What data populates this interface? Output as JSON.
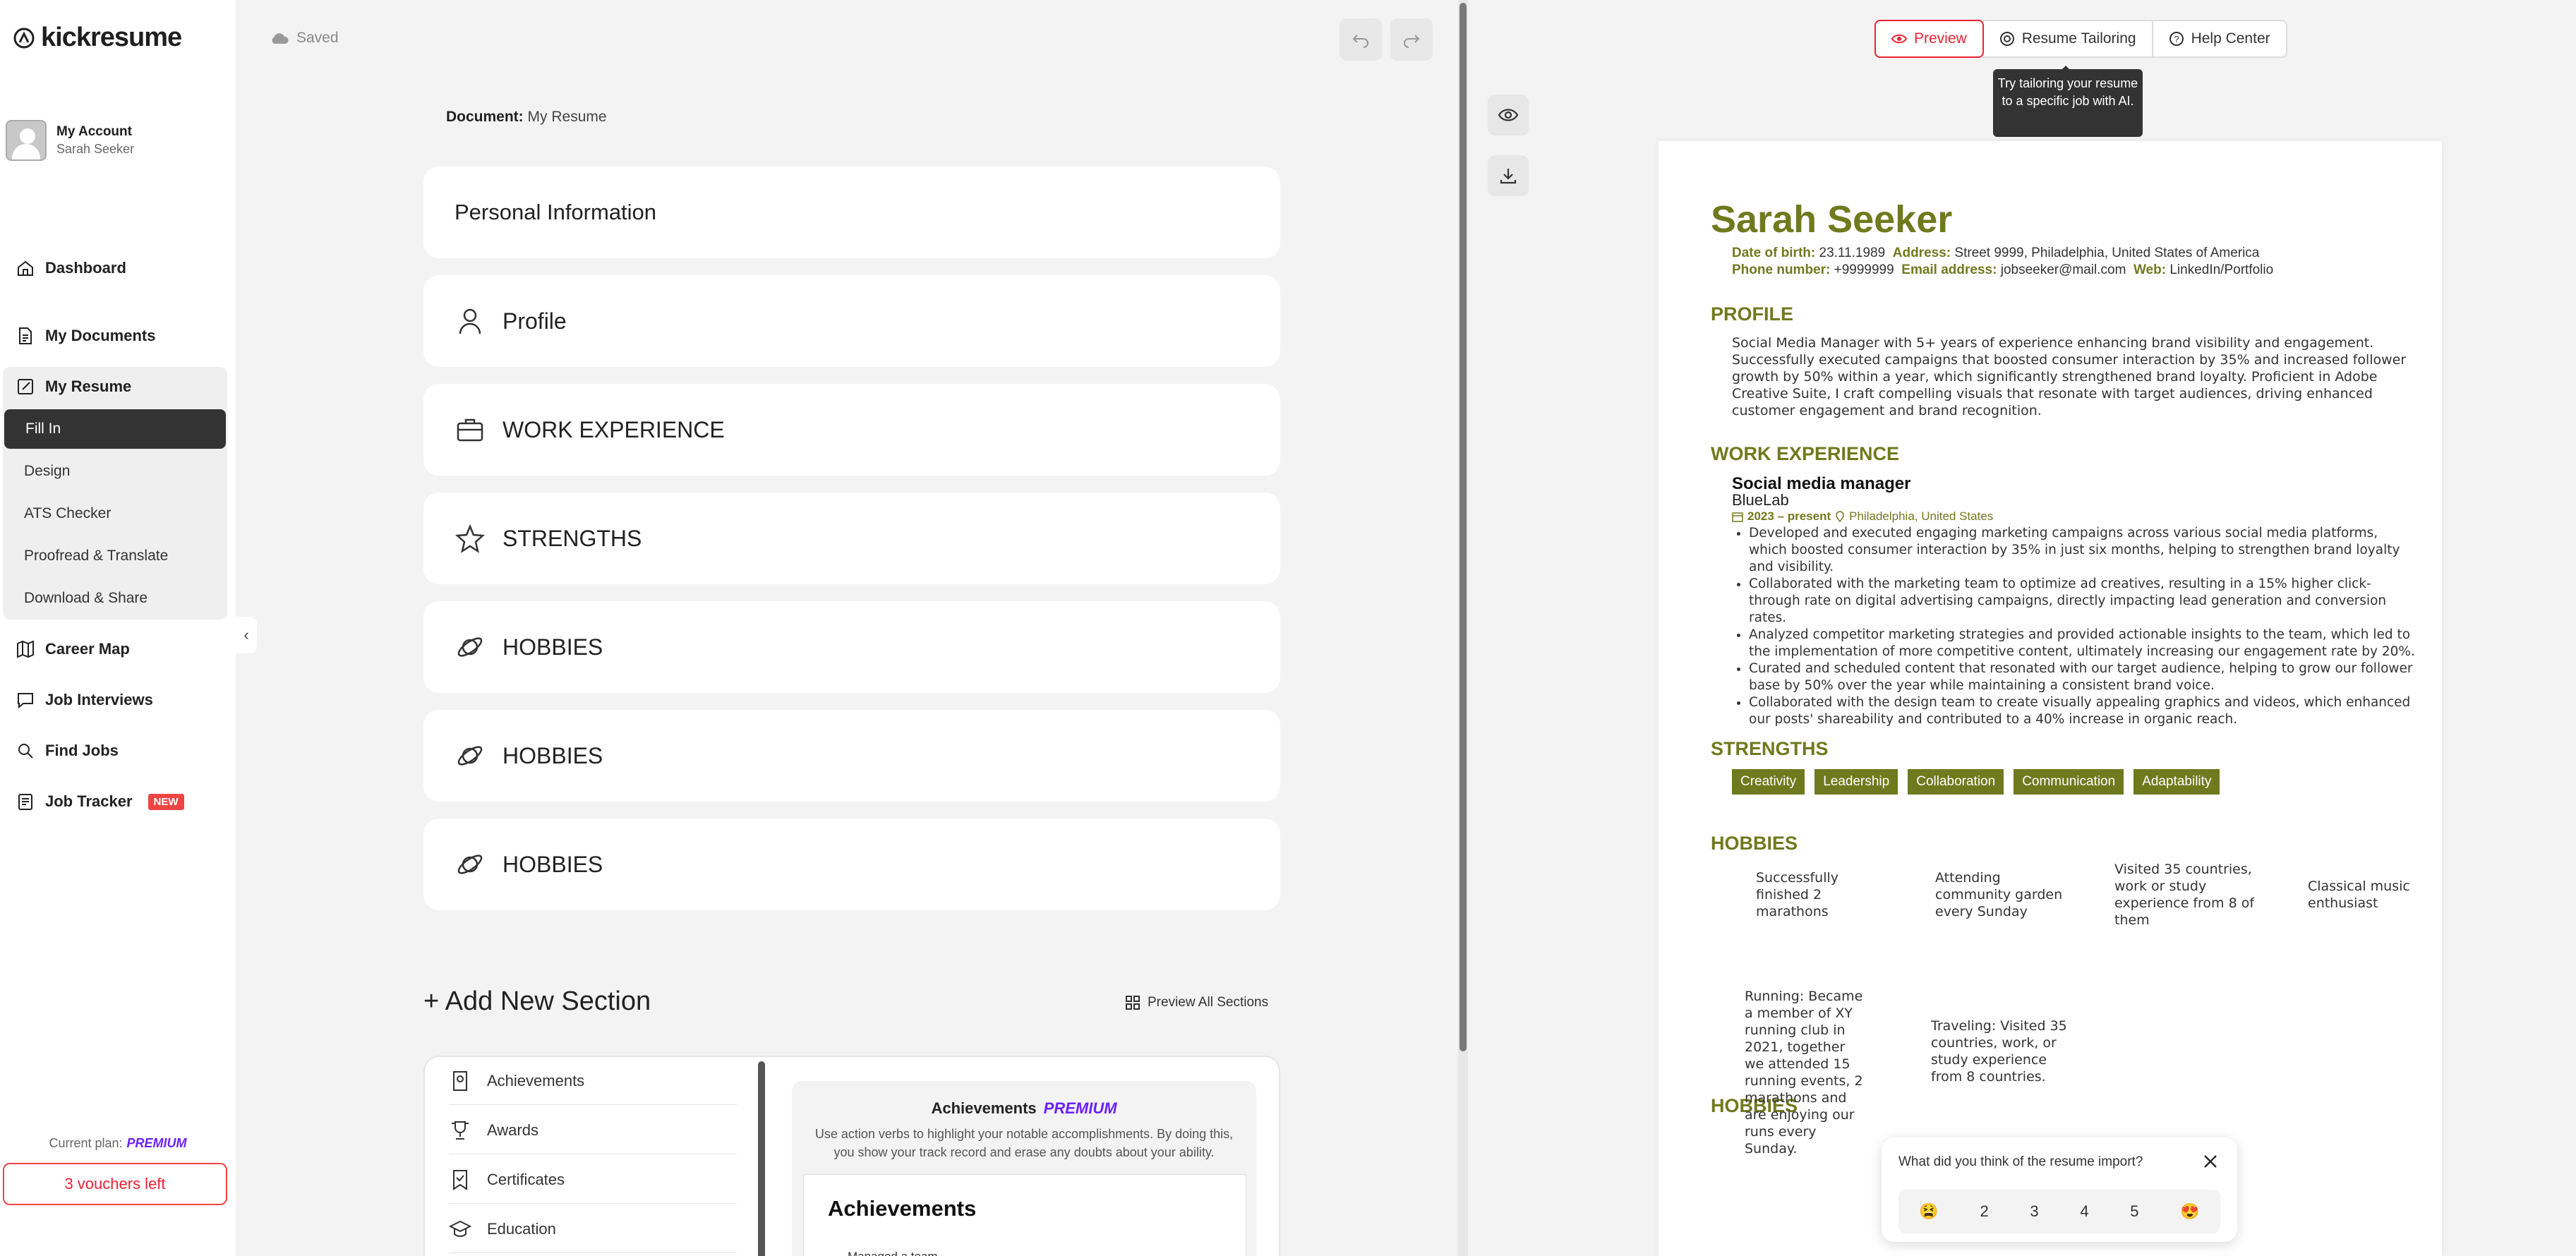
{
  "app": {
    "logo_text": "kickresume"
  },
  "account": {
    "label": "My Account",
    "user": "Sarah Seeker"
  },
  "nav": {
    "dashboard": "Dashboard",
    "my_documents": "My Documents",
    "my_resume": "My Resume",
    "sub": [
      "Fill In",
      "Design",
      "ATS Checker",
      "Proofread & Translate",
      "Download & Share"
    ],
    "career_map": "Career Map",
    "job_interviews": "Job Interviews",
    "find_jobs": "Find Jobs",
    "job_tracker": "Job Tracker",
    "new_badge": "NEW"
  },
  "plan": {
    "label": "Current plan:",
    "value": "PREMIUM",
    "vouchers": "3 vouchers left"
  },
  "editor": {
    "saved": "Saved",
    "doc_label": "Document:",
    "doc_name": "My Resume",
    "sections": [
      "Personal Information",
      "Profile",
      "WORK EXPERIENCE",
      "STRENGTHS",
      "HOBBIES",
      "HOBBIES",
      "HOBBIES"
    ],
    "add_section": "+ Add New Section",
    "preview_all": "Preview All Sections",
    "library": [
      "Achievements",
      "Awards",
      "Certificates",
      "Education"
    ],
    "lib_preview": {
      "title": "Achievements",
      "premium": "PREMIUM",
      "desc": "Use action verbs to highlight your notable accomplishments. By doing this, you show your track record and erase any doubts about your ability.",
      "card_title": "Achievements",
      "card_line": "Managed a team..."
    }
  },
  "preview": {
    "tabs": [
      "Preview",
      "Resume Tailoring",
      "Help Center"
    ],
    "tooltip": "Try tailoring your resume to a specific job with AI."
  },
  "resume": {
    "name": "Sarah Seeker",
    "dob_label": "Date of birth:",
    "dob": "23.11.1989",
    "address_label": "Address:",
    "address": "Street 9999, Philadelphia, United States of America",
    "phone_label": "Phone number:",
    "phone": "+9999999",
    "email_label": "Email address:",
    "email": "jobseeker@mail.com",
    "web_label": "Web:",
    "web": "LinkedIn/Portfolio",
    "profile_h": "PROFILE",
    "profile_text": "Social Media Manager with 5+ years of experience enhancing brand visibility and engagement. Successfully executed campaigns that boosted consumer interaction by 35% and increased follower growth by 50% within a year, which significantly strengthened brand loyalty. Proficient in Adobe Creative Suite, I craft compelling visuals that resonate with target audiences, driving enhanced customer engagement and brand recognition.",
    "work_h": "WORK EXPERIENCE",
    "job_title": "Social media manager",
    "company": "BlueLab",
    "job_dates": "2023 – present",
    "job_location": "Philadelphia, United States",
    "bullets": [
      "Developed and executed engaging marketing campaigns across various social media platforms, which boosted consumer interaction by 35% in just six months, helping to strengthen brand loyalty and visibility.",
      "Collaborated with the marketing team to optimize ad creatives, resulting in a 15% higher click-through rate on digital advertising campaigns, directly impacting lead generation and conversion rates.",
      "Analyzed competitor marketing strategies and provided actionable insights to the team, which led to the implementation of more competitive content, ultimately increasing our engagement rate by 20%.",
      "Curated and scheduled content that resonated with our target audience, helping to grow our follower base by 50% over the year while maintaining a consistent brand voice.",
      "Collaborated with the design team to create visually appealing graphics and videos, which enhanced our posts' shareability and contributed to a 40% increase in organic reach."
    ],
    "strengths_h": "STRENGTHS",
    "strengths": [
      "Creativity",
      "Leadership",
      "Collaboration",
      "Communication",
      "Adaptability"
    ],
    "hobbies_h1": "HOBBIES",
    "hobbies1": [
      "Successfully finished 2 marathons",
      "Attending community garden every Sunday",
      "Visited 35 countries, work or study experience from 8 of them",
      "Classical music enthusiast"
    ],
    "hobbies_h2": "HOBBIES",
    "hobbies2": [
      "Running: Became a member of XY running club in 2021, together we attended 15 running events, 2 marathons and are enjoying our runs every Sunday.",
      "Traveling: Visited 35 countries, work, or study experience from 8 countries."
    ]
  },
  "feedback": {
    "question": "What did you think of the resume import?",
    "scale": [
      "😫",
      "2",
      "3",
      "4",
      "5",
      "😍"
    ]
  }
}
